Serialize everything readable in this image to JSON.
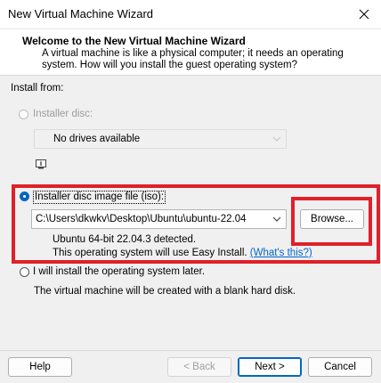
{
  "window": {
    "title": "New Virtual Machine Wizard"
  },
  "header": {
    "title": "Welcome to the New Virtual Machine Wizard",
    "description": "A virtual machine is like a physical computer; it needs an operating system. How will you install the guest operating system?"
  },
  "install": {
    "section_label": "Install from:",
    "installer_disc": {
      "label": "Installer disc:",
      "selected": false,
      "enabled": false,
      "dropdown_value": "No drives available"
    },
    "iso": {
      "label": "Installer disc image file (iso):",
      "selected": true,
      "path": "C:\\Users\\dkwkv\\Desktop\\Ubuntu\\ubuntu-22.04",
      "browse_label": "Browse...",
      "detected_text": "Ubuntu 64-bit 22.04.3 detected.",
      "easy_install_text": "This operating system will use Easy Install.",
      "whats_this_link": "(What's this?)"
    },
    "later": {
      "label": "I will install the operating system later.",
      "selected": false,
      "description": "The virtual machine will be created with a blank hard disk."
    }
  },
  "footer": {
    "help": "Help",
    "back": "< Back",
    "next": "Next >",
    "cancel": "Cancel"
  },
  "colors": {
    "accent": "#0067c0",
    "highlight": "#e0202a",
    "link": "#0066cc"
  }
}
